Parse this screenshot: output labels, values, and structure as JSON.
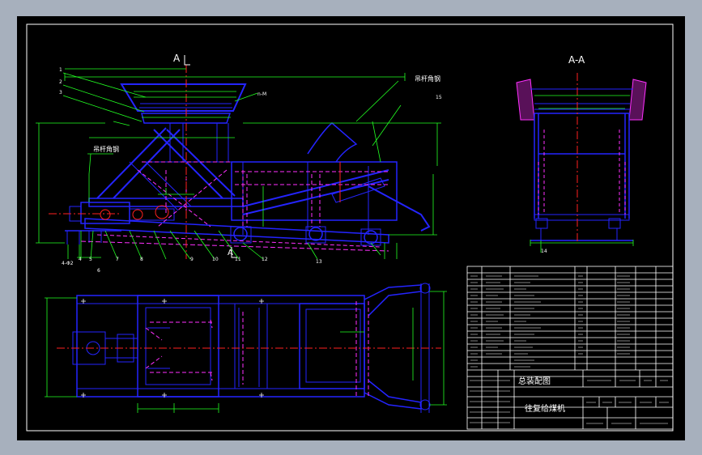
{
  "section_mark": "A",
  "section_view_title": "A-A",
  "callouts": {
    "c1": "1",
    "c2": "2",
    "c3": "3",
    "c4": "4",
    "c5": "5",
    "c6": "6",
    "c7": "7",
    "c8": "8",
    "c9": "9",
    "c10": "10",
    "c11": "11",
    "c12": "12",
    "c13": "13",
    "c14": "14",
    "c15": "15"
  },
  "annotations": {
    "lifting_1": "吊杆角钢",
    "lifting_2": "吊杆角钢",
    "holes": "n-M",
    "bolt": "4-Φ2"
  },
  "title_block": {
    "product_name": "往复给煤机",
    "drawing_name": "总装配图"
  },
  "colors": {
    "background": "#000000",
    "frame": "#ffffff",
    "blue": "#2424ff",
    "green": "#22ff22",
    "red": "#ff2020",
    "magenta": "#ff30ff",
    "dim": "#22ff22"
  }
}
